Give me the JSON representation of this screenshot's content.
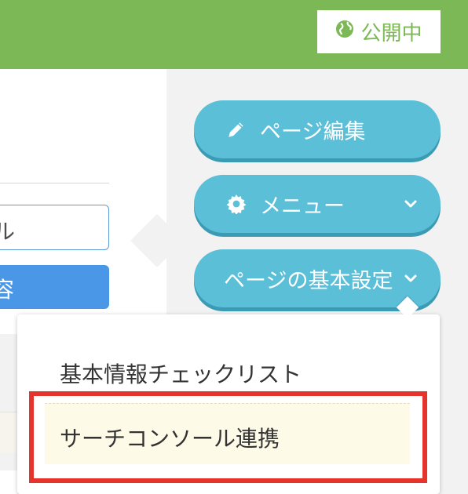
{
  "header": {
    "status_label": "公開中",
    "accent_color": "#7cb856"
  },
  "main": {
    "input_value_partial": "ル",
    "button_label_partial": "容"
  },
  "actions": {
    "edit_page_label": "ページ編集",
    "menu_label": "メニュー",
    "page_settings_label": "ページの基本設定",
    "button_color": "#5bbfd8"
  },
  "dropdown": {
    "items": [
      {
        "label": "基本情報チェックリスト"
      },
      {
        "label": "サーチコンソール連携"
      }
    ],
    "highlight_color": "#e5342b"
  }
}
